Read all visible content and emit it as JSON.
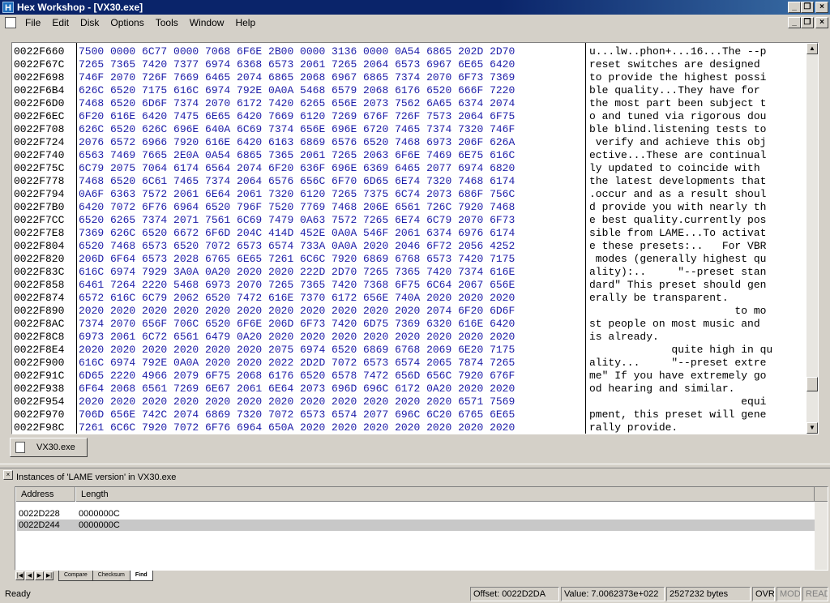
{
  "window": {
    "title": "Hex Workshop - [VX30.exe]",
    "app_icon_glyph": "H",
    "btn_minimize": "_",
    "btn_restore": "❐",
    "btn_close": "×"
  },
  "menu": {
    "items": [
      {
        "label": "File"
      },
      {
        "label": "Edit"
      },
      {
        "label": "Disk"
      },
      {
        "label": "Options"
      },
      {
        "label": "Tools"
      },
      {
        "label": "Window"
      },
      {
        "label": "Help"
      }
    ]
  },
  "hex": {
    "rows": [
      {
        "addr": "0022F660",
        "bytes": "7500 0000 6C77 0000 7068 6F6E 2B00 0000 3136 0000 0A54 6865 202D 2D70",
        "text": "u...lw..phon+...16...The --p"
      },
      {
        "addr": "0022F67C",
        "bytes": "7265 7365 7420 7377 6974 6368 6573 2061 7265 2064 6573 6967 6E65 6420",
        "text": "reset switches are designed "
      },
      {
        "addr": "0022F698",
        "bytes": "746F 2070 726F 7669 6465 2074 6865 2068 6967 6865 7374 2070 6F73 7369",
        "text": "to provide the highest possi"
      },
      {
        "addr": "0022F6B4",
        "bytes": "626C 6520 7175 616C 6974 792E 0A0A 5468 6579 2068 6176 6520 666F 7220",
        "text": "ble quality...They have for "
      },
      {
        "addr": "0022F6D0",
        "bytes": "7468 6520 6D6F 7374 2070 6172 7420 6265 656E 2073 7562 6A65 6374 2074",
        "text": "the most part been subject t"
      },
      {
        "addr": "0022F6EC",
        "bytes": "6F20 616E 6420 7475 6E65 6420 7669 6120 7269 676F 726F 7573 2064 6F75",
        "text": "o and tuned via rigorous dou"
      },
      {
        "addr": "0022F708",
        "bytes": "626C 6520 626C 696E 640A 6C69 7374 656E 696E 6720 7465 7374 7320 746F",
        "text": "ble blind.listening tests to"
      },
      {
        "addr": "0022F724",
        "bytes": "2076 6572 6966 7920 616E 6420 6163 6869 6576 6520 7468 6973 206F 626A",
        "text": " verify and achieve this obj"
      },
      {
        "addr": "0022F740",
        "bytes": "6563 7469 7665 2E0A 0A54 6865 7365 2061 7265 2063 6F6E 7469 6E75 616C",
        "text": "ective...These are continual"
      },
      {
        "addr": "0022F75C",
        "bytes": "6C79 2075 7064 6174 6564 2074 6F20 636F 696E 6369 6465 2077 6974 6820",
        "text": "ly updated to coincide with "
      },
      {
        "addr": "0022F778",
        "bytes": "7468 6520 6C61 7465 7374 2064 6576 656C 6F70 6D65 6E74 7320 7468 6174",
        "text": "the latest developments that"
      },
      {
        "addr": "0022F794",
        "bytes": "0A6F 6363 7572 2061 6E64 2061 7320 6120 7265 7375 6C74 2073 686F 756C",
        "text": ".occur and as a result shoul"
      },
      {
        "addr": "0022F7B0",
        "bytes": "6420 7072 6F76 6964 6520 796F 7520 7769 7468 206E 6561 726C 7920 7468",
        "text": "d provide you with nearly th"
      },
      {
        "addr": "0022F7CC",
        "bytes": "6520 6265 7374 2071 7561 6C69 7479 0A63 7572 7265 6E74 6C79 2070 6F73",
        "text": "e best quality.currently pos"
      },
      {
        "addr": "0022F7E8",
        "bytes": "7369 626C 6520 6672 6F6D 204C 414D 452E 0A0A 546F 2061 6374 6976 6174",
        "text": "sible from LAME...To activat"
      },
      {
        "addr": "0022F804",
        "bytes": "6520 7468 6573 6520 7072 6573 6574 733A 0A0A 2020 2046 6F72 2056 4252",
        "text": "e these presets:..   For VBR"
      },
      {
        "addr": "0022F820",
        "bytes": "206D 6F64 6573 2028 6765 6E65 7261 6C6C 7920 6869 6768 6573 7420 7175",
        "text": " modes (generally highest qu"
      },
      {
        "addr": "0022F83C",
        "bytes": "616C 6974 7929 3A0A 0A20 2020 2020 222D 2D70 7265 7365 7420 7374 616E",
        "text": "ality):..     \"--preset stan"
      },
      {
        "addr": "0022F858",
        "bytes": "6461 7264 2220 5468 6973 2070 7265 7365 7420 7368 6F75 6C64 2067 656E",
        "text": "dard\" This preset should gen"
      },
      {
        "addr": "0022F874",
        "bytes": "6572 616C 6C79 2062 6520 7472 616E 7370 6172 656E 740A 2020 2020 2020",
        "text": "erally be transparent.      "
      },
      {
        "addr": "0022F890",
        "bytes": "2020 2020 2020 2020 2020 2020 2020 2020 2020 2020 2020 2074 6F20 6D6F",
        "text": "                       to mo"
      },
      {
        "addr": "0022F8AC",
        "bytes": "7374 2070 656F 706C 6520 6F6E 206D 6F73 7420 6D75 7369 6320 616E 6420",
        "text": "st people on most music and "
      },
      {
        "addr": "0022F8C8",
        "bytes": "6973 2061 6C72 6561 6479 0A20 2020 2020 2020 2020 2020 2020 2020 2020",
        "text": "is already.                 "
      },
      {
        "addr": "0022F8E4",
        "bytes": "2020 2020 2020 2020 2020 2020 2075 6974 6520 6869 6768 2069 6E20 7175",
        "text": "             quite high in qu"
      },
      {
        "addr": "0022F900",
        "bytes": "616C 6974 792E 0A0A 2020 2020 2022 2D2D 7072 6573 6574 2065 7874 7265",
        "text": "ality...     \"--preset extre"
      },
      {
        "addr": "0022F91C",
        "bytes": "6D65 2220 4966 2079 6F75 2068 6176 6520 6578 7472 656D 656C 7920 676F",
        "text": "me\" If you have extremely go"
      },
      {
        "addr": "0022F938",
        "bytes": "6F64 2068 6561 7269 6E67 2061 6E64 2073 696D 696C 6172 0A20 2020 2020",
        "text": "od hearing and similar.     "
      },
      {
        "addr": "0022F954",
        "bytes": "2020 2020 2020 2020 2020 2020 2020 2020 2020 2020 2020 2020 6571 7569",
        "text": "                        equi"
      },
      {
        "addr": "0022F970",
        "bytes": "706D 656E 742C 2074 6869 7320 7072 6573 6574 2077 696C 6C20 6765 6E65",
        "text": "pment, this preset will gene"
      },
      {
        "addr": "0022F98C",
        "bytes": "7261 6C6C 7920 7072 6F76 6964 650A 2020 2020 2020 2020 2020 2020 2020",
        "text": "rally provide."
      }
    ]
  },
  "doc_tab": {
    "label": "VX30.exe"
  },
  "results": {
    "title": "Instances of 'LAME version' in VX30.exe",
    "col_address": "Address",
    "col_length": "Length",
    "rows": [
      {
        "address": "0022D228",
        "length": "0000000C"
      },
      {
        "address": "0022D244",
        "length": "0000000C"
      }
    ],
    "tabs": [
      {
        "label": "Compare"
      },
      {
        "label": "Checksum"
      },
      {
        "label": "Find"
      }
    ]
  },
  "status": {
    "ready": "Ready",
    "offset": "Offset: 0022D2DA",
    "value": "Value: 7.0062373e+022",
    "size": "2527232 bytes",
    "ovr": "OVR",
    "mod": "MOD",
    "read": "READ"
  }
}
